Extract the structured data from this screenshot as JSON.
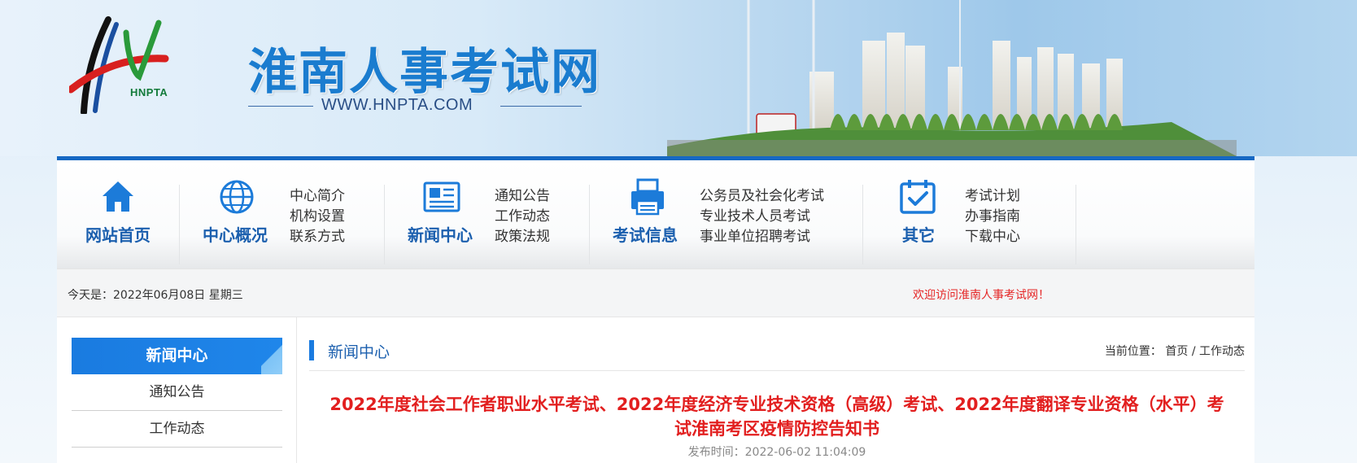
{
  "banner": {
    "logo_text": "HNPTA",
    "site_title": "淮南人事考试网",
    "site_url": "WWW.HNPTA.COM"
  },
  "nav": {
    "groups": [
      {
        "title": "网站首页",
        "icon": "home-icon",
        "links": []
      },
      {
        "title": "中心概况",
        "icon": "globe-icon",
        "links": [
          "中心简介",
          "机构设置",
          "联系方式"
        ]
      },
      {
        "title": "新闻中心",
        "icon": "newspaper-icon",
        "links": [
          "通知公告",
          "工作动态",
          "政策法规"
        ]
      },
      {
        "title": "考试信息",
        "icon": "printer-icon",
        "links": [
          "公务员及社会化考试",
          "专业技术人员考试",
          "事业单位招聘考试"
        ]
      },
      {
        "title": "其它",
        "icon": "calendar-check-icon",
        "links": [
          "考试计划",
          "办事指南",
          "下载中心"
        ]
      }
    ]
  },
  "infobar": {
    "today": "今天是：2022年06月08日 星期三",
    "welcome": "欢迎访问淮南人事考试网！"
  },
  "sidebar": {
    "heading": "新闻中心",
    "items": [
      "通知公告",
      "工作动态"
    ]
  },
  "main": {
    "section_title": "新闻中心",
    "location_label": "当前位置：",
    "breadcrumb_home": "首页",
    "breadcrumb_sep": " / ",
    "breadcrumb_current": "工作动态",
    "article_title": "2022年度社会工作者职业水平考试、2022年度经济专业技术资格（高级）考试、2022年度翻译专业资格（水平）考试淮南考区疫情防控告知书",
    "publish_time": "发布时间：2022-06-02 11:04:09"
  },
  "colors": {
    "brand_blue": "#1668c3",
    "title_red": "#e21f1f",
    "welcome_red": "#e52727"
  }
}
